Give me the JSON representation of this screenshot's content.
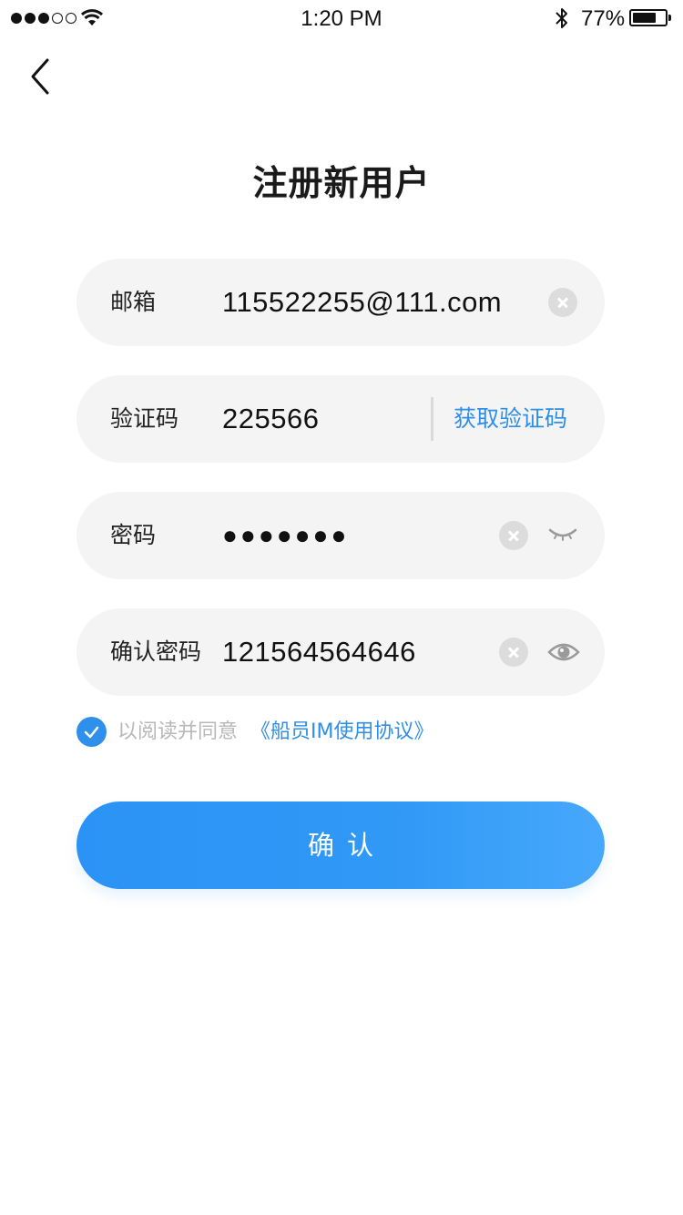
{
  "status_bar": {
    "time": "1:20 PM",
    "battery_percent_text": "77%",
    "battery_level": 0.77,
    "signal_bars_filled": 3,
    "signal_bars_total": 5
  },
  "header": {
    "back_icon": "chevron-left-icon",
    "title": "注册新用户"
  },
  "form": {
    "email": {
      "label": "邮箱",
      "value": "115522255@111.com"
    },
    "code": {
      "label": "验证码",
      "value": "225566",
      "get_code_label": "获取验证码"
    },
    "password": {
      "label": "密码",
      "masked_value": "●●●●●●●",
      "eye_icon": "eye-closed-icon"
    },
    "confirm_password": {
      "label": "确认密码",
      "value": "121564564646",
      "eye_icon": "eye-open-icon"
    }
  },
  "agreement": {
    "checked": true,
    "text": "以阅读并同意",
    "link_text": "《船员IM使用协议》"
  },
  "confirm_button": {
    "label": "确认"
  },
  "colors": {
    "accent": "#2f8fe8",
    "button_start": "#2b93f5",
    "button_end": "#47a8fb",
    "field_bg": "#f4f4f4",
    "placeholder_gray": "#b8b8b8"
  }
}
